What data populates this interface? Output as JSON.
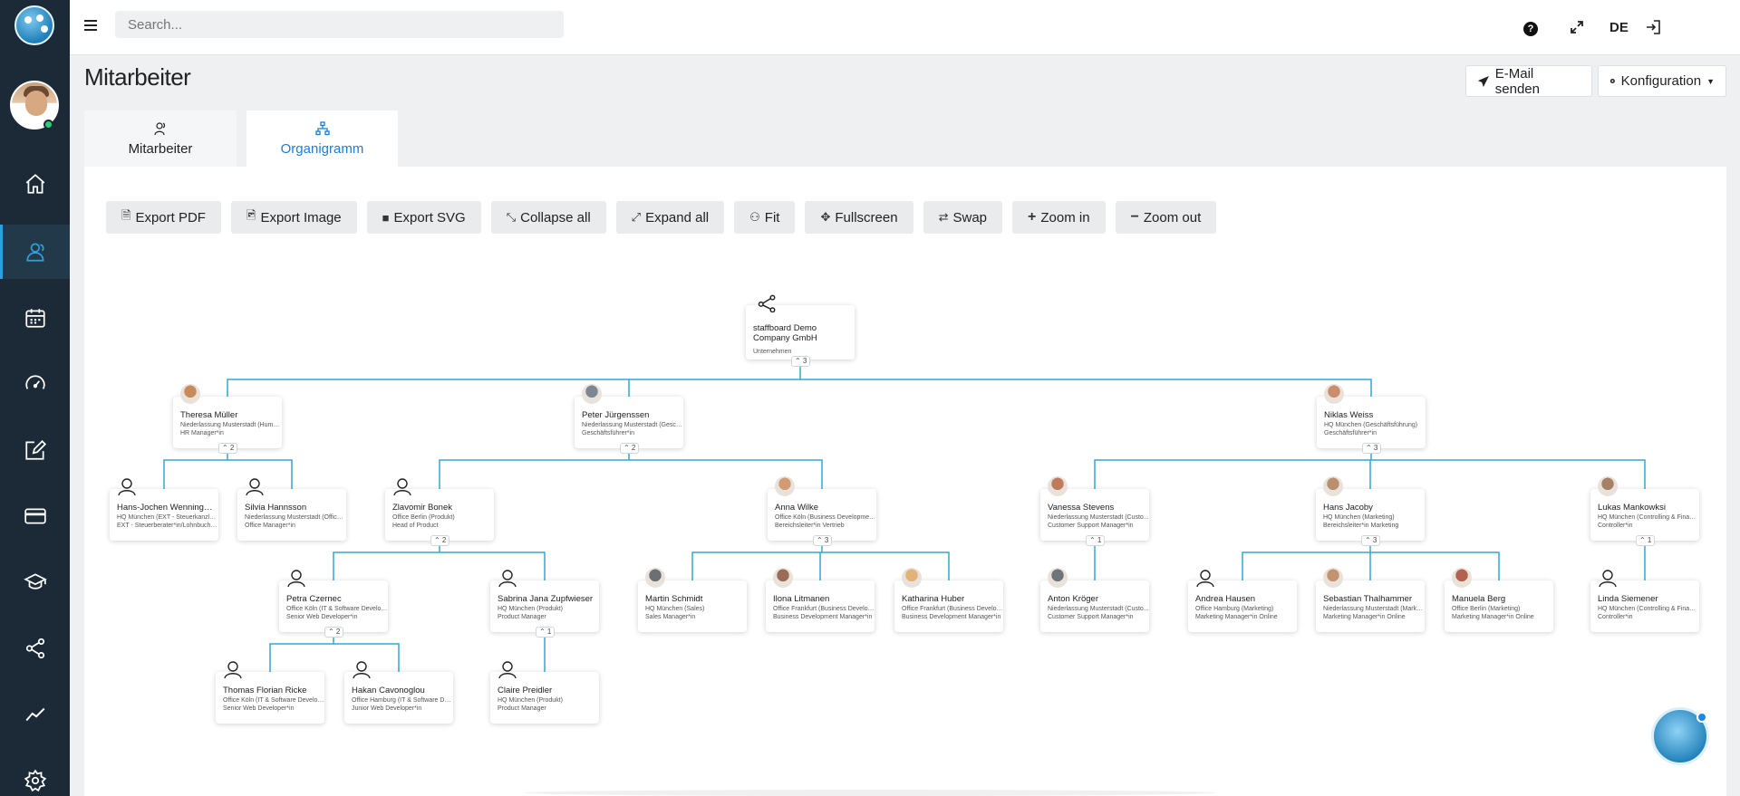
{
  "topbar": {
    "search_placeholder": "Search...",
    "help_label": "?",
    "language": "DE"
  },
  "page": {
    "title": "Mitarbeiter",
    "mail_button": "E-Mail senden",
    "config_button": "Konfiguration"
  },
  "tabs": [
    {
      "label": "Mitarbeiter",
      "active": false
    },
    {
      "label": "Organigramm",
      "active": true
    }
  ],
  "toolbar": [
    {
      "label": "Export PDF",
      "icon": "file-pdf-icon"
    },
    {
      "label": "Export Image",
      "icon": "file-image-icon"
    },
    {
      "label": "Export SVG",
      "icon": "file-icon"
    },
    {
      "label": "Collapse all",
      "icon": "compress-icon"
    },
    {
      "label": "Expand all",
      "icon": "expand-icon"
    },
    {
      "label": "Fit",
      "icon": "sitemap-icon"
    },
    {
      "label": "Fullscreen",
      "icon": "arrows-icon"
    },
    {
      "label": "Swap",
      "icon": "swap-icon"
    },
    {
      "label": "Zoom in",
      "icon": "plus-icon"
    },
    {
      "label": "Zoom out",
      "icon": "minus-icon"
    }
  ],
  "colors": {
    "sidebar": "#1b2a36",
    "accent": "#1a7ed6",
    "connector": "#35a7d6"
  },
  "org": {
    "root": {
      "name": "staffboard Demo Company GmbH",
      "type": "Unternehmen",
      "children_toggle": "⌃ 3"
    },
    "people": [
      {
        "id": "theresa",
        "name": "Theresa Müller",
        "dept": "Niederlassung Musterstadt (Human...",
        "role": "HR Manager*in",
        "toggle": "⌃ 2"
      },
      {
        "id": "peter",
        "name": "Peter Jürgenssen",
        "dept": "Niederlassung Musterstadt (Geschä...",
        "role": "Geschäftsführer*in",
        "toggle": "⌃ 2"
      },
      {
        "id": "niklas",
        "name": "Niklas Weiss",
        "dept": "HQ München (Geschäftsführung)",
        "role": "Geschäftsführer*in",
        "toggle": "⌃ 3"
      },
      {
        "id": "hansjochen",
        "name": "Hans-Jochen Wenningmeier",
        "dept": "HQ München (EXT - Steuerkanzlei/L...",
        "role": "EXT - Steuerberater*in/Lohnbuchha..."
      },
      {
        "id": "silvia",
        "name": "Silvia Hannsson",
        "dept": "Niederlassung Musterstadt (Office ...",
        "role": "Office Manager*in"
      },
      {
        "id": "zlavomir",
        "name": "Zlavomir Bonek",
        "dept": "Office Berlin (Produkt)",
        "role": "Head of Product",
        "toggle": "⌃ 2"
      },
      {
        "id": "anna",
        "name": "Anna Wilke",
        "dept": "Office Köln (Business Development)",
        "role": "Bereichsleiter*in Vertrieb",
        "toggle": "⌃ 3"
      },
      {
        "id": "vanessa",
        "name": "Vanessa Stevens",
        "dept": "Niederlassung Musterstadt (Custo...",
        "role": "Customer Support Manager*in",
        "toggle": "⌃ 1"
      },
      {
        "id": "hansjacoby",
        "name": "Hans Jacoby",
        "dept": "HQ München (Marketing)",
        "role": "Bereichsleiter*in Marketing",
        "toggle": "⌃ 3"
      },
      {
        "id": "lukas",
        "name": "Lukas Mankowksi",
        "dept": "HQ München (Controlling & Finance)",
        "role": "Controller*in",
        "toggle": "⌃ 1"
      },
      {
        "id": "petra",
        "name": "Petra Czernec",
        "dept": "Office Köln (IT & Software Develop...",
        "role": "Senior Web Developer*in",
        "toggle": "⌃ 2"
      },
      {
        "id": "sabrina",
        "name": "Sabrina Jana Zupfwieser",
        "dept": "HQ München (Produkt)",
        "role": "Product Manager",
        "toggle": "⌃ 1"
      },
      {
        "id": "martin",
        "name": "Martin Schmidt",
        "dept": "HQ München (Sales)",
        "role": "Sales Manager*in"
      },
      {
        "id": "ilona",
        "name": "Ilona Litmanen",
        "dept": "Office Frankfurt (Business Develop...",
        "role": "Business Development Manager*in"
      },
      {
        "id": "katharina",
        "name": "Katharina Huber",
        "dept": "Office Frankfurt (Business Develop...",
        "role": "Business Development Manager*in"
      },
      {
        "id": "anton",
        "name": "Anton Kröger",
        "dept": "Niederlassung Musterstadt (Custo...",
        "role": "Customer Support Manager*in"
      },
      {
        "id": "andrea",
        "name": "Andrea Hausen",
        "dept": "Office Hamburg (Marketing)",
        "role": "Marketing Manager*in Online"
      },
      {
        "id": "sebastian",
        "name": "Sebastian Thalhammer",
        "dept": "Niederlassung Musterstadt (Market...",
        "role": "Marketing Manager*in Online"
      },
      {
        "id": "manuela",
        "name": "Manuela Berg",
        "dept": "Office Berlin (Marketing)",
        "role": "Marketing Manager*in Online"
      },
      {
        "id": "linda",
        "name": "Linda Siemener",
        "dept": "HQ München (Controlling & Finance)",
        "role": "Controller*in"
      },
      {
        "id": "thomas",
        "name": "Thomas Florian Ricke",
        "dept": "Office Köln (IT & Software Develop...",
        "role": "Senior Web Developer*in"
      },
      {
        "id": "hakan",
        "name": "Hakan Cavonoglou",
        "dept": "Office Hamburg (IT & Software Dev...",
        "role": "Junior Web Developer*in"
      },
      {
        "id": "claire",
        "name": "Claire Preidler",
        "dept": "HQ München (Produkt)",
        "role": "Product Manager"
      }
    ]
  }
}
